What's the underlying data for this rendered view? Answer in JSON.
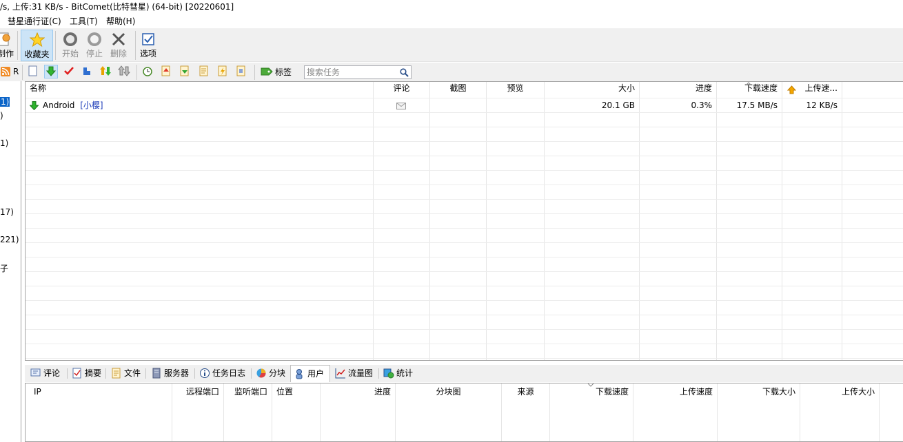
{
  "window": {
    "title": "/s, 上传:31 KB/s - BitComet(比特彗星) (64-bit) [20220601]"
  },
  "menu": {
    "items": [
      "彗星通行证(C)",
      "工具(T)",
      "帮助(H)"
    ]
  },
  "toolbar": {
    "make_label": "制作",
    "favorites_label": "收藏夹",
    "start_label": "开始",
    "stop_label": "停止",
    "delete_label": "删除",
    "options_label": "选项"
  },
  "subtoolbar": {
    "rss_label": "R",
    "tag_label": "标签",
    "search_placeholder": "搜索任务"
  },
  "left_pane": {
    "items": [
      "1)",
      ")",
      "1)",
      "17)",
      "221)",
      "子"
    ]
  },
  "task_table": {
    "headers": {
      "name": "名称",
      "comment": "评论",
      "screenshot": "截图",
      "preview": "预览",
      "size": "大小",
      "progress": "进度",
      "download_speed": "下载速度",
      "upload_speed": "上传速..."
    },
    "rows": [
      {
        "name": "Android",
        "tag": "[小樱]",
        "size": "20.1 GB",
        "progress": "0.3%",
        "download_speed": "17.5 MB/s",
        "upload_speed": "12 KB/s"
      }
    ]
  },
  "tabs": [
    "评论",
    "摘要",
    "文件",
    "服务器",
    "任务日志",
    "分块",
    "用户",
    "流量图",
    "统计"
  ],
  "selected_tab": "用户",
  "peers_table": {
    "headers": {
      "ip": "IP",
      "remote_port": "远程端口",
      "listen_port": "监听端口",
      "location": "位置",
      "progress": "进度",
      "pieces": "分块图",
      "source": "来源",
      "download_speed": "下载速度",
      "upload_speed": "上传速度",
      "downloaded": "下载大小",
      "uploaded": "上传大小"
    }
  }
}
